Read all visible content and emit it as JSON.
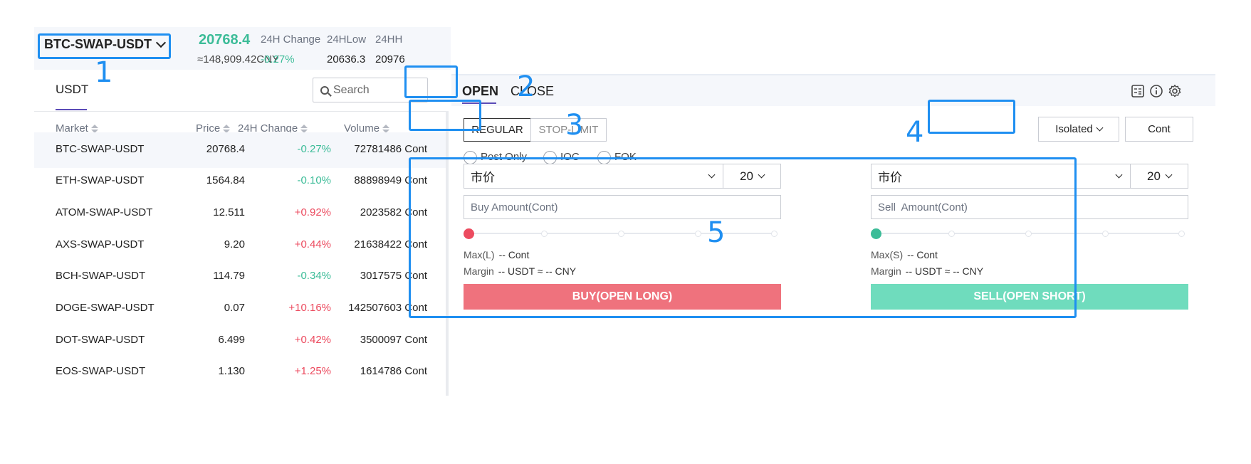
{
  "ticker": {
    "pair": "BTC-SWAP-USDT",
    "last_price": "20768.4",
    "cny_price": "≈148,909.42CNY",
    "change_label": "24H Change",
    "change_value": "-0.27%",
    "low_label": "24HLow",
    "low_value": "20636.3",
    "high_label": "24HH",
    "high_value": "20976"
  },
  "market": {
    "tab": "USDT",
    "search_placeholder": "Search",
    "columns": [
      "Market",
      "Price",
      "24H Change",
      "Volume"
    ],
    "rows": [
      {
        "market": "BTC-SWAP-USDT",
        "price": "20768.4",
        "change": "-0.27%",
        "volume": "72781486 Cont"
      },
      {
        "market": "ETH-SWAP-USDT",
        "price": "1564.84",
        "change": "-0.10%",
        "volume": "88898949 Cont"
      },
      {
        "market": "ATOM-SWAP-USDT",
        "price": "12.511",
        "change": "+0.92%",
        "volume": "2023582 Cont"
      },
      {
        "market": "AXS-SWAP-USDT",
        "price": "9.20",
        "change": "+0.44%",
        "volume": "21638422 Cont"
      },
      {
        "market": "BCH-SWAP-USDT",
        "price": "114.79",
        "change": "-0.34%",
        "volume": "3017575 Cont"
      },
      {
        "market": "DOGE-SWAP-USDT",
        "price": "0.07",
        "change": "+10.16%",
        "volume": "142507603 Cont"
      },
      {
        "market": "DOT-SWAP-USDT",
        "price": "6.499",
        "change": "+0.42%",
        "volume": "3500097 Cont"
      },
      {
        "market": "EOS-SWAP-USDT",
        "price": "1.130",
        "change": "+1.25%",
        "volume": "1614786 Cont"
      }
    ]
  },
  "trade": {
    "tab_open": "OPEN",
    "tab_close": "CLOSE",
    "order_regular": "REGULAR",
    "order_stop_limit": "STOP-LIMIT",
    "margin_mode": "Isolated",
    "unit": "Cont",
    "options": [
      "Post Only",
      "IOC",
      "FOK"
    ],
    "buy": {
      "order_type": "市价",
      "leverage": "20",
      "amount_placeholder": "Buy Amount(Cont)",
      "max_label": "Max(L)",
      "max_value": "-- Cont",
      "margin_label": "Margin",
      "margin_value": "-- USDT ≈ -- CNY",
      "button": "BUY(OPEN LONG)",
      "slider_value": 0
    },
    "sell": {
      "order_type": "市价",
      "leverage": "20",
      "amount_placeholder": "Sell  Amount(Cont)",
      "max_label": "Max(S)",
      "max_value": "-- Cont",
      "margin_label": "Margin",
      "margin_value": "-- USDT ≈ -- CNY",
      "button": "SELL(OPEN SHORT)",
      "slider_value": 0
    }
  },
  "annotations": [
    "1",
    "2",
    "3",
    "4",
    "5"
  ],
  "colors": {
    "green": "#3cbc98",
    "red": "#ec4b5f",
    "buy_button": "#ef727d",
    "sell_button": "#6fdcbd",
    "accent_underline": "#5b4bb7",
    "annotation_blue": "#1f8ff1"
  },
  "icons": [
    "search-icon",
    "calculator-icon",
    "info-icon",
    "settings-gear-icon",
    "chevron-down-icon",
    "sort-icon"
  ]
}
